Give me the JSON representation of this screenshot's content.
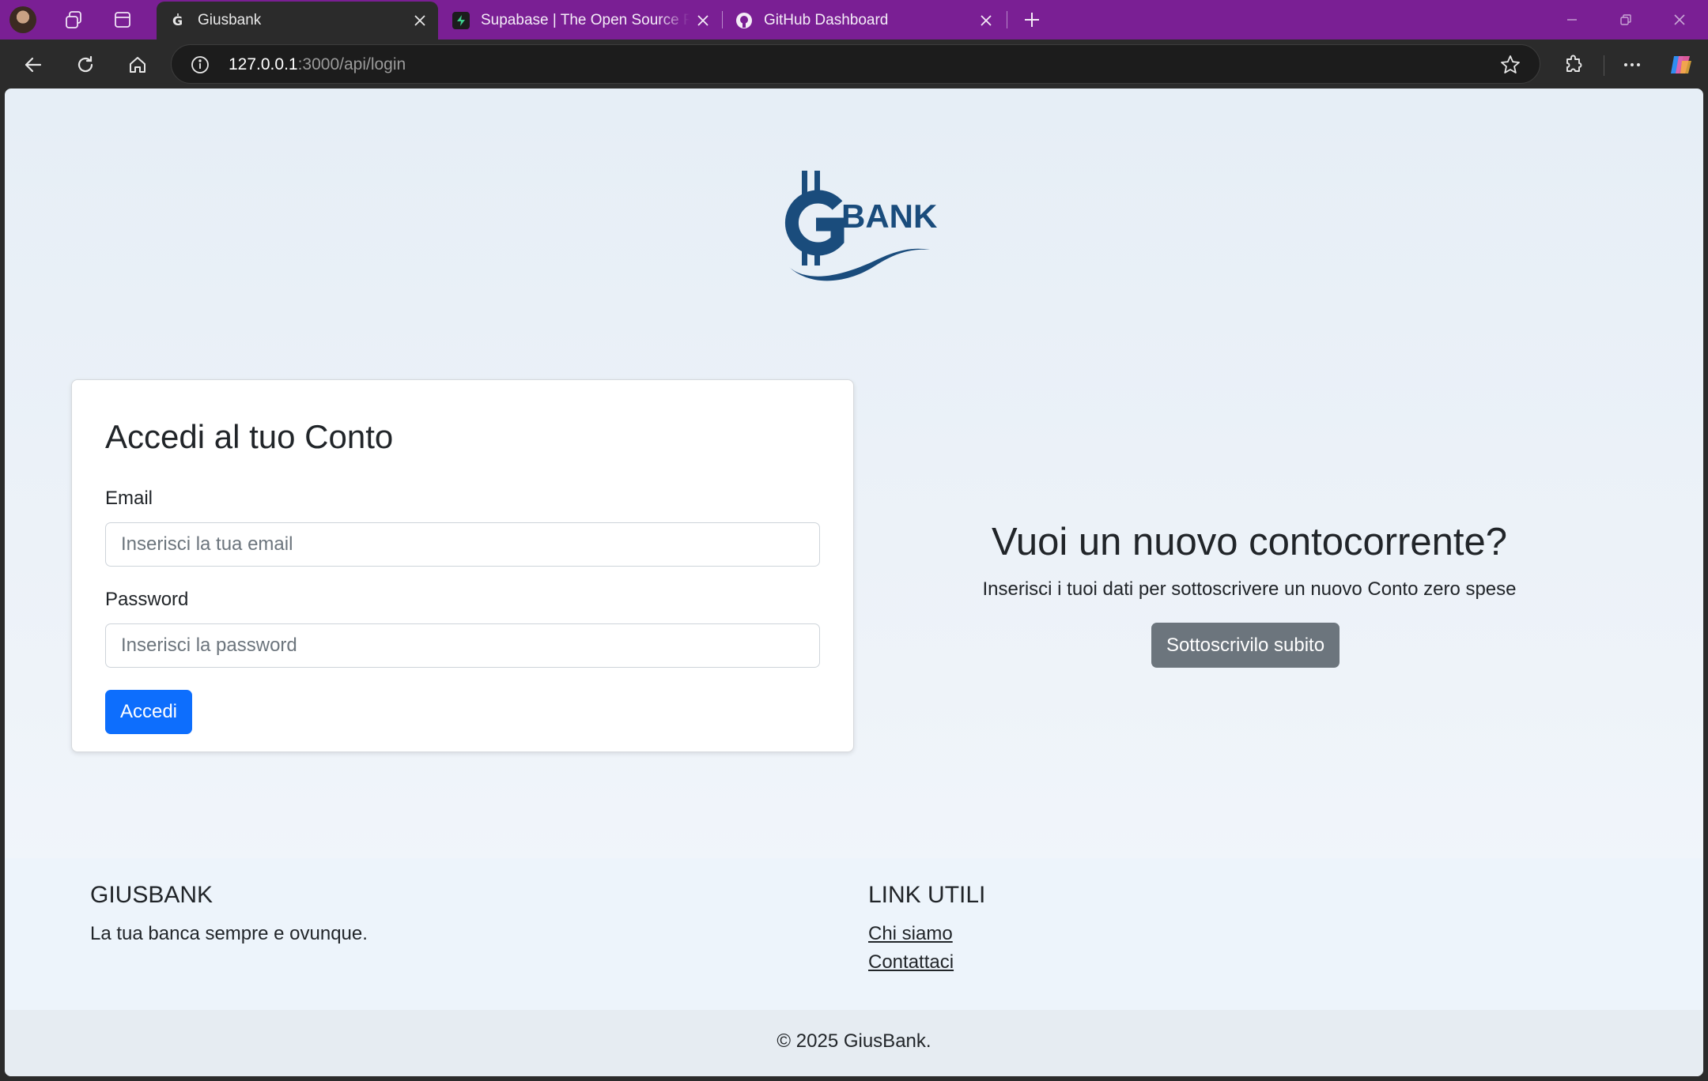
{
  "browser": {
    "tabs": [
      {
        "title": "Giusbank",
        "active": true
      },
      {
        "title": "Supabase | The Open Source Firebase Alternative",
        "active": false
      },
      {
        "title": "GitHub Dashboard",
        "active": false
      }
    ],
    "url_host": "127.0.0.1",
    "url_rest": ":3000/api/login",
    "colors": {
      "tabstrip": "#7a1f94",
      "toolbar": "#2b2b2b"
    }
  },
  "page": {
    "logo_text": "BANK",
    "login": {
      "title": "Accedi al tuo Conto",
      "email_label": "Email",
      "email_placeholder": "Inserisci la tua email",
      "password_label": "Password",
      "password_placeholder": "Inserisci la password",
      "submit_label": "Accedi"
    },
    "promo": {
      "title": "Vuoi un nuovo contocorrente?",
      "subtitle": "Inserisci i tuoi dati per sottoscrivere un nuovo Conto zero spese",
      "button_label": "Sottoscrivilo subito"
    },
    "footer": {
      "brand_title": "GIUSBANK",
      "brand_tagline": "La tua banca sempre e ovunque.",
      "links_title": "LINK UTILI",
      "links": [
        "Chi siamo",
        "Contattaci"
      ],
      "copyright": "© 2025 GiusBank."
    },
    "colors": {
      "primary": "#0d6efd",
      "secondary": "#6c757d",
      "logo": "#1a4c7c"
    }
  }
}
